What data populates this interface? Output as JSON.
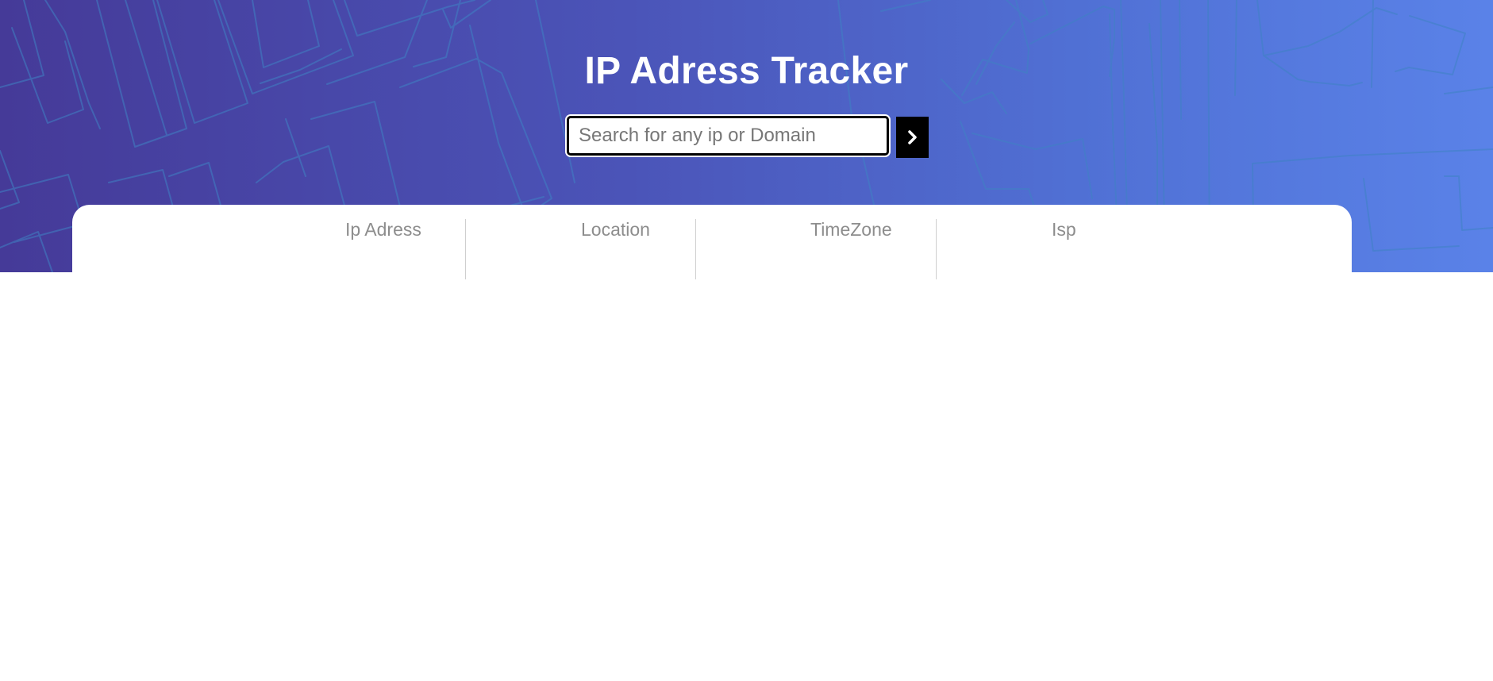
{
  "header": {
    "title": "IP Adress Tracker"
  },
  "search": {
    "placeholder": "Search for any ip or Domain",
    "value": "",
    "submit_icon": "chevron-right-icon"
  },
  "info_panel": {
    "labels": {
      "ip_address": "Ip Adress",
      "location": "Location",
      "timezone": "TimeZone",
      "isp": "Isp"
    },
    "values": {
      "ip_address": "",
      "location": "",
      "timezone": "",
      "isp": ""
    }
  },
  "colors": {
    "hero_gradient_start": "#453a98",
    "hero_gradient_end": "#5a82e8",
    "map_lines": "#3f82c4",
    "title_text": "#ffffff",
    "button_background": "#000000",
    "label_text": "#8d8d8d"
  }
}
